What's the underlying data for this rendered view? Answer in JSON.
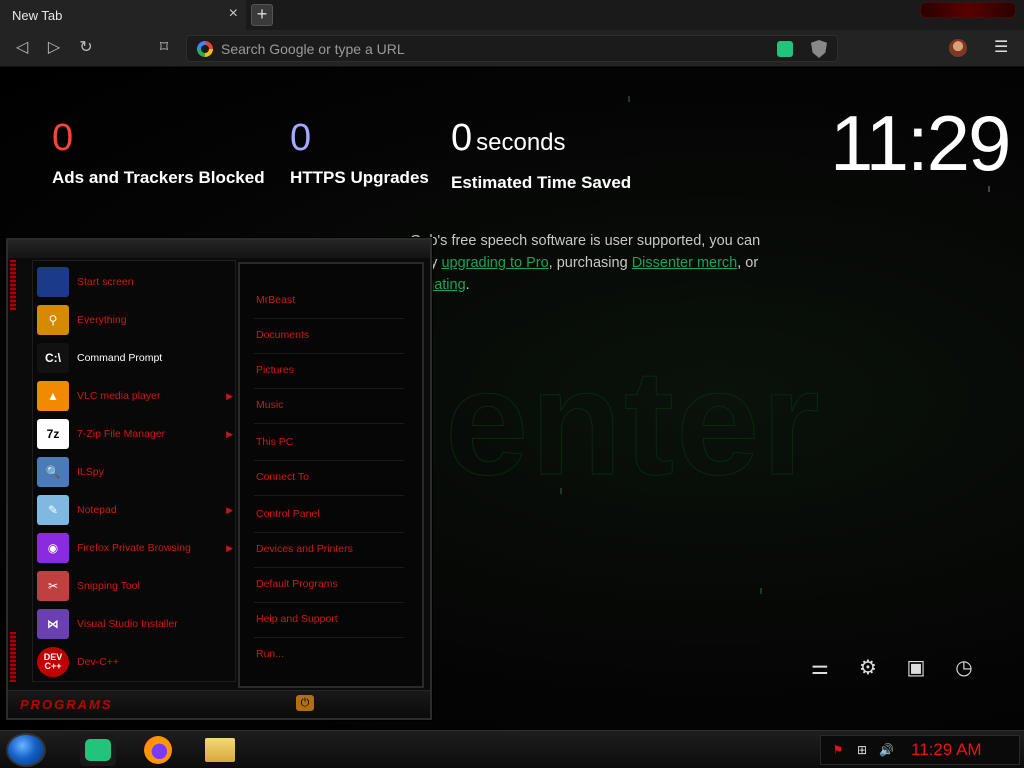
{
  "browser": {
    "tab_title": "New Tab",
    "close_glyph": "×",
    "new_tab_glyph": "+",
    "url_placeholder": "Search Google or type a URL",
    "menu_glyph": "☰"
  },
  "stats": [
    {
      "value": "0",
      "label": "Ads and Trackers Blocked",
      "color": "#f2473b"
    },
    {
      "value": "0",
      "label": "HTTPS Upgrades",
      "color": "#a4a8ff"
    },
    {
      "value": "0",
      "unit": "seconds",
      "label": "Estimated Time Saved",
      "color": "#ffffff"
    }
  ],
  "clock": "11:29",
  "support": {
    "text1": "Gab's free speech software is user supported, you can",
    "text2_prefix": "p by ",
    "link_pro": "upgrading to Pro",
    "text2_mid": ", purchasing ",
    "link_merch": "Dissenter merch",
    "text2_suffix": ", or",
    "link_donate": "donating",
    "text3_suffix": "."
  },
  "background_word": "enter",
  "start_menu": {
    "programs": [
      {
        "label": "Start screen",
        "icon": "start-screen-icon",
        "color": "#1c3a8a",
        "has_arrow": false,
        "glyph": ""
      },
      {
        "label": "Everything",
        "icon": "magnifier-icon",
        "color": "#d58a00",
        "has_arrow": false,
        "glyph": "⚲"
      },
      {
        "label": "Command Prompt",
        "icon": "command-prompt-icon",
        "color": "#111111",
        "has_arrow": false,
        "glyph": "C:\\",
        "highlight": true
      },
      {
        "label": "VLC media player",
        "icon": "vlc-cone-icon",
        "color": "#f28a00",
        "has_arrow": true,
        "glyph": "▲"
      },
      {
        "label": "7-Zip File Manager",
        "icon": "sevenzip-icon",
        "color": "#ffffff",
        "has_arrow": true,
        "glyph": "7z"
      },
      {
        "label": "ILSpy",
        "icon": "ilspy-icon",
        "color": "#4a7ab8",
        "has_arrow": false,
        "glyph": "🔍"
      },
      {
        "label": "Notepad",
        "icon": "notepad-icon",
        "color": "#7fb8e0",
        "has_arrow": true,
        "glyph": "✎"
      },
      {
        "label": "Firefox Private Browsing",
        "icon": "firefox-private-icon",
        "color": "#8a2be2",
        "has_arrow": true,
        "glyph": "◉"
      },
      {
        "label": "Snipping Tool",
        "icon": "scissors-icon",
        "color": "#c04040",
        "has_arrow": false,
        "glyph": "✂"
      },
      {
        "label": "Visual Studio Installer",
        "icon": "visual-studio-icon",
        "color": "#6a3fb0",
        "has_arrow": false,
        "glyph": "⋈"
      },
      {
        "label": "Dev-C++",
        "icon": "devcpp-icon",
        "color": "#c00000",
        "has_arrow": false,
        "glyph": "DEV C++"
      }
    ],
    "places": [
      "MrBeast",
      "Documents",
      "Pictures",
      "Music",
      "This PC",
      "Connect To",
      "Control Panel",
      "Devices and Printers",
      "Default Programs",
      "Help and Support",
      "Run..."
    ],
    "footer_title": "PROGRAMS"
  },
  "taskbar": {
    "clock": "11:29 AM"
  }
}
